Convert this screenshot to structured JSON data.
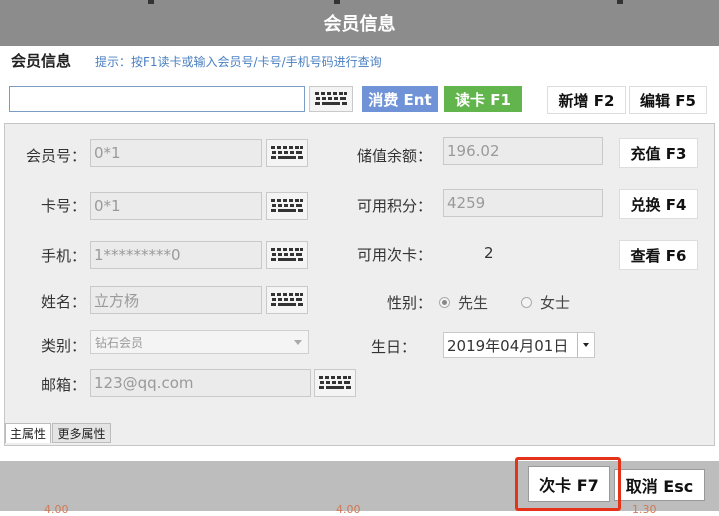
{
  "window": {
    "title": "会员信息"
  },
  "header": {
    "heading": "会员信息",
    "hint": "提示：按F1读卡或输入会员号/卡号/手机号码进行查询"
  },
  "search": {
    "value": "",
    "placeholder": ""
  },
  "toolbar": {
    "consume": "消费 Ent",
    "read_card": "读卡 F1",
    "add": "新增 F2",
    "edit": "编辑 F5"
  },
  "form": {
    "member_no": {
      "label": "会员号：",
      "value": "0*1"
    },
    "card_no": {
      "label": "卡号：",
      "value": "0*1"
    },
    "phone": {
      "label": "手机：",
      "value": "1*********0"
    },
    "name": {
      "label": "姓名：",
      "value": "立方杨"
    },
    "category": {
      "label": "类别：",
      "value": "钻石会员"
    },
    "email": {
      "label": "邮箱：",
      "value": "123@qq.com"
    },
    "balance": {
      "label": "储值余额：",
      "value": "196.02"
    },
    "points": {
      "label": "可用积分：",
      "value": "4259"
    },
    "times_card": {
      "label": "可用次卡：",
      "value": "2"
    },
    "gender": {
      "label": "性别：",
      "options": [
        "先生",
        "女士"
      ],
      "selected": "先生"
    },
    "birthday": {
      "label": "生日：",
      "value": "2019年04月01日"
    }
  },
  "side_buttons": {
    "recharge": "充值 F3",
    "exchange": "兑换 F4",
    "view": "查看 F6"
  },
  "tabs": [
    {
      "label": "主属性",
      "active": true
    },
    {
      "label": "更多属性",
      "active": false
    }
  ],
  "footer": {
    "times_card": "次卡 F7",
    "cancel": "取消 Esc"
  },
  "underlay": {
    "left": "4.00",
    "mid": "4.00",
    "right": "1.30"
  },
  "colors": {
    "title_bar": "#8c8c8c",
    "consume_button": "#6f93d6",
    "read_card_button": "#62b54d",
    "highlight": "#e4321b",
    "hint_text": "#4a7fc1"
  }
}
